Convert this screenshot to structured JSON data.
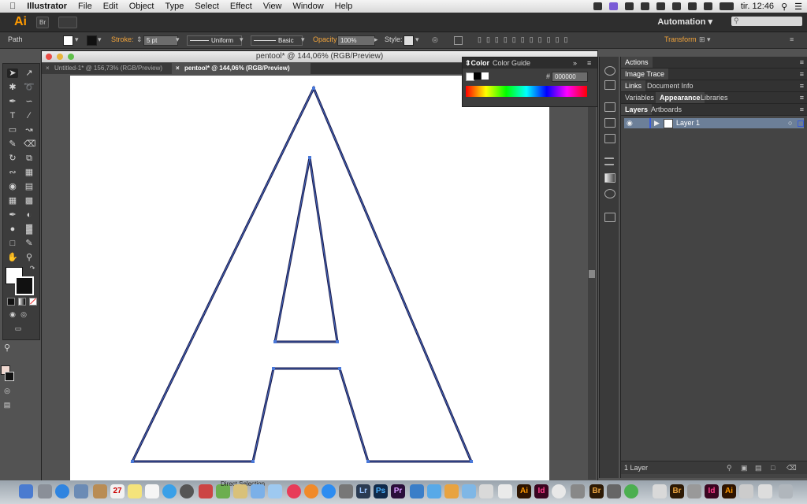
{
  "menubar": {
    "app_name": "Illustrator",
    "items": [
      "File",
      "Edit",
      "Object",
      "Type",
      "Select",
      "Effect",
      "View",
      "Window",
      "Help"
    ],
    "clock": "tir. 12:46"
  },
  "appbar": {
    "logo": "Ai",
    "bridge_btn": "Br",
    "workspace": "Automation"
  },
  "control": {
    "selection": "Path",
    "stroke_label": "Stroke:",
    "stroke_value": "5 pt",
    "profile": "Uniform",
    "brush": "Basic",
    "opacity_label": "Opacity:",
    "opacity_value": "100%",
    "style_label": "Style:",
    "transform_label": "Transform"
  },
  "document": {
    "window_title": "pentool* @ 144,06% (RGB/Preview)",
    "tabs": [
      {
        "label": "Untitled-1* @ 156,73% (RGB/Preview)"
      },
      {
        "label": "pentool* @ 144,06% (RGB/Preview)"
      }
    ]
  },
  "color_panel": {
    "tabs": [
      "Color",
      "Color Guide"
    ],
    "hash": "#",
    "hex": "000000"
  },
  "right_panels": {
    "rows": [
      {
        "tabs": [
          "Actions"
        ]
      },
      {
        "tabs": [
          "Image Trace"
        ]
      },
      {
        "tabs": [
          "Links",
          "Document Info"
        ]
      },
      {
        "tabs": [
          "Variables",
          "Appearance",
          "Libraries"
        ]
      },
      {
        "tabs": [
          "Layers",
          "Artboards"
        ]
      }
    ],
    "layer_name": "Layer 1",
    "layers_count": "1 Layer"
  },
  "dock": {
    "apps": [
      "Lr",
      "Ps",
      "Pr",
      "Ai",
      "Id",
      "Br",
      "Id",
      "Ai"
    ],
    "tooltip": "Direct Selection"
  },
  "colors": {
    "accent": "#f2a43b",
    "path_stroke": "#1d1d4d",
    "anchor_blue": "#4a78d8"
  }
}
